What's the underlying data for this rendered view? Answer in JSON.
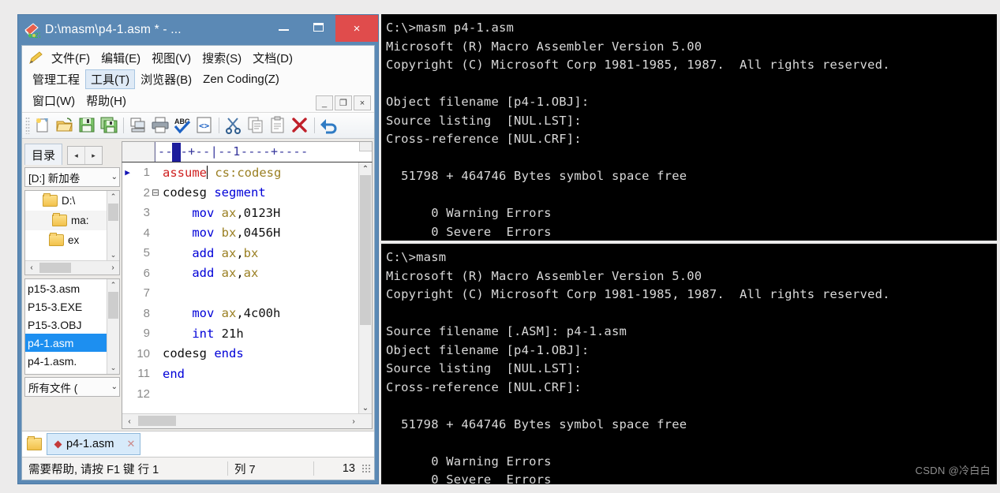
{
  "editor_window": {
    "title": "D:\\masm\\p4-1.asm * - ...",
    "logo_icon": "notepad-plus-logo-icon",
    "title_buttons": {
      "minimize": "–",
      "maximize": "❐",
      "close": "×"
    },
    "menus_row1": [
      "文件(F)",
      "编辑(E)",
      "视图(V)",
      "搜索(S)",
      "文档(D)"
    ],
    "menus_row2": [
      "管理工程",
      "工具(T)",
      "浏览器(B)",
      "Zen Coding(Z)"
    ],
    "menus_row3": [
      "窗口(W)",
      "帮助(H)"
    ],
    "mdi_buttons": [
      "_",
      "❐",
      "×"
    ],
    "toolbar_icons": [
      "new-file-icon",
      "open-folder-icon",
      "save-icon",
      "save-all-icon",
      "print-preview-icon",
      "print-icon",
      "spellcheck-icon",
      "code-tags-icon",
      "cut-scissors-icon",
      "copy-icon",
      "paste-icon",
      "delete-x-icon",
      "undo-icon"
    ],
    "sidebar": {
      "tab_label": "目录",
      "nav_prev": "◂",
      "nav_next": "▸",
      "drive_combo_value": "[D:] 新加卷",
      "drive_combo_caret": "⌄",
      "tree": [
        {
          "label": "D:\\",
          "depth": 0,
          "icon": "folder-icon"
        },
        {
          "label": "ma:",
          "depth": 1,
          "icon": "folder-icon"
        },
        {
          "label": "ex",
          "depth": 2,
          "icon": "folder-icon"
        }
      ],
      "files": [
        {
          "name": "p15-3.asm",
          "selected": false
        },
        {
          "name": "P15-3.EXE",
          "selected": false
        },
        {
          "name": "P15-3.OBJ",
          "selected": false
        },
        {
          "name": "p4-1.asm",
          "selected": true
        },
        {
          "name": "p4-1.asm.",
          "selected": false
        }
      ],
      "filter_combo_value": "所有文件 (",
      "filter_combo_caret": "⌄",
      "scroll_up": "⌃",
      "scroll_down": "⌄",
      "scroll_left": "‹",
      "scroll_right": "›"
    },
    "ruler_text": "----+--|--1----+----",
    "code_lines": [
      {
        "num": "1",
        "fold": "",
        "marker": "▶",
        "indent": 1,
        "tokens": [
          {
            "t": "assume",
            "c": "kw-red"
          },
          {
            "t": " ",
            "c": "plain"
          },
          {
            "t": "cs:codesg",
            "c": "reg"
          }
        ]
      },
      {
        "num": "2",
        "fold": "⊟",
        "marker": "",
        "indent": 0,
        "tokens": [
          {
            "t": "codesg ",
            "c": "plain"
          },
          {
            "t": "segment",
            "c": "kw"
          }
        ]
      },
      {
        "num": "3",
        "fold": "",
        "marker": "",
        "indent": 3,
        "tokens": [
          {
            "t": "mov ",
            "c": "kw"
          },
          {
            "t": "ax",
            "c": "reg"
          },
          {
            "t": ",0123H",
            "c": "num"
          }
        ]
      },
      {
        "num": "4",
        "fold": "",
        "marker": "",
        "indent": 3,
        "tokens": [
          {
            "t": "mov ",
            "c": "kw"
          },
          {
            "t": "bx",
            "c": "reg"
          },
          {
            "t": ",0456H",
            "c": "num"
          }
        ]
      },
      {
        "num": "5",
        "fold": "",
        "marker": "",
        "indent": 3,
        "tokens": [
          {
            "t": "add ",
            "c": "kw"
          },
          {
            "t": "ax",
            "c": "reg"
          },
          {
            "t": ",",
            "c": "num"
          },
          {
            "t": "bx",
            "c": "reg"
          }
        ]
      },
      {
        "num": "6",
        "fold": "",
        "marker": "",
        "indent": 3,
        "tokens": [
          {
            "t": "add ",
            "c": "kw"
          },
          {
            "t": "ax",
            "c": "reg"
          },
          {
            "t": ",",
            "c": "num"
          },
          {
            "t": "ax",
            "c": "reg"
          }
        ]
      },
      {
        "num": "7",
        "fold": "",
        "marker": "",
        "indent": 0,
        "tokens": []
      },
      {
        "num": "8",
        "fold": "",
        "marker": "",
        "indent": 3,
        "tokens": [
          {
            "t": "mov ",
            "c": "kw"
          },
          {
            "t": "ax",
            "c": "reg"
          },
          {
            "t": ",4c00h",
            "c": "num"
          }
        ]
      },
      {
        "num": "9",
        "fold": "",
        "marker": "",
        "indent": 3,
        "tokens": [
          {
            "t": "int ",
            "c": "kw"
          },
          {
            "t": "21h",
            "c": "num"
          }
        ]
      },
      {
        "num": "10",
        "fold": "",
        "marker": "",
        "indent": 0,
        "tokens": [
          {
            "t": "codesg ",
            "c": "plain"
          },
          {
            "t": "ends",
            "c": "kw"
          }
        ]
      },
      {
        "num": "11",
        "fold": "",
        "marker": "",
        "indent": 0,
        "tokens": [
          {
            "t": "end",
            "c": "kw"
          }
        ]
      },
      {
        "num": "12",
        "fold": "",
        "marker": "",
        "indent": 0,
        "tokens": []
      }
    ],
    "doc_tab": {
      "label": "p4-1.asm",
      "modified_marker": "◆",
      "close": "✕",
      "folder_icon": "folder-icon"
    },
    "statusbar": {
      "hint": "需要帮助, 请按 F1 键  行 1",
      "column": "列 7",
      "count": "13"
    }
  },
  "console_top": {
    "lines": [
      "C:\\>masm p4-1.asm",
      "Microsoft (R) Macro Assembler Version 5.00",
      "Copyright (C) Microsoft Corp 1981-1985, 1987.  All rights reserved.",
      "",
      "Object filename [p4-1.OBJ]:",
      "Source listing  [NUL.LST]:",
      "Cross-reference [NUL.CRF]:",
      "",
      "  51798 + 464746 Bytes symbol space free",
      "",
      "      0 Warning Errors",
      "      0 Severe  Errors"
    ]
  },
  "console_bottom": {
    "lines": [
      "C:\\>masm",
      "Microsoft (R) Macro Assembler Version 5.00",
      "Copyright (C) Microsoft Corp 1981-1985, 1987.  All rights reserved.",
      "",
      "Source filename [.ASM]: p4-1.asm",
      "Object filename [p4-1.OBJ]:",
      "Source listing  [NUL.LST]:",
      "Cross-reference [NUL.CRF]:",
      "",
      "  51798 + 464746 Bytes symbol space free",
      "",
      "      0 Warning Errors",
      "      0 Severe  Errors"
    ]
  },
  "watermark": "CSDN @冷白白",
  "colors": {
    "window_frame": "#5b89b5",
    "close_button": "#e04c4c",
    "selection": "#1d8ff0",
    "page_background": "#ecebeb",
    "console_background": "#000000",
    "console_text": "#d9d9d9"
  }
}
